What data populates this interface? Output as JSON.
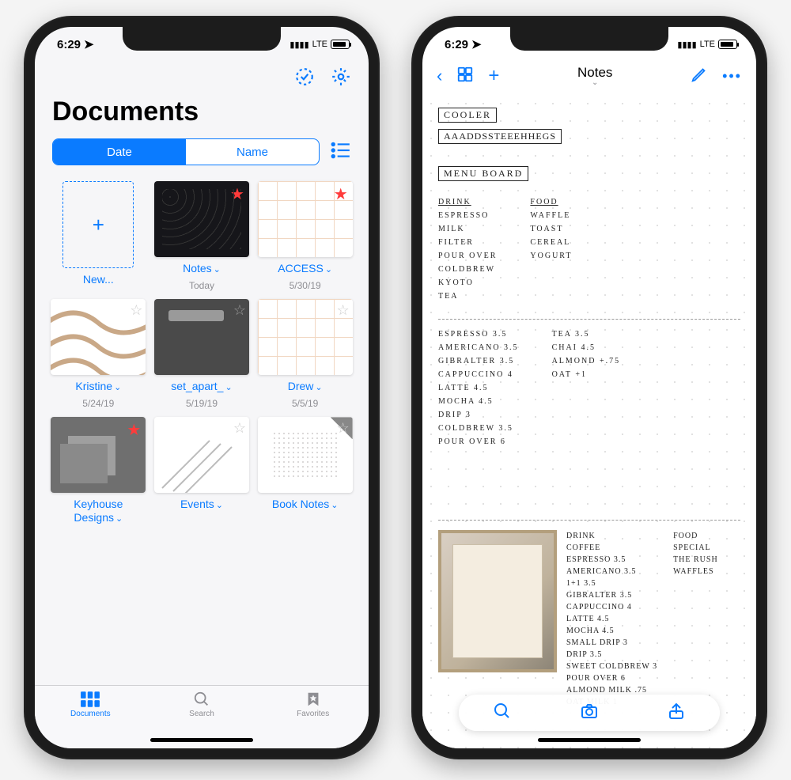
{
  "status": {
    "time": "6:29",
    "net": "LTE"
  },
  "left": {
    "title": "Documents",
    "segmented": {
      "date": "Date",
      "name": "Name"
    },
    "docs": [
      {
        "label": "New..."
      },
      {
        "label": "Notes",
        "date": "Today"
      },
      {
        "label": "ACCESS",
        "date": "5/30/19"
      },
      {
        "label": "Kristine",
        "date": "5/24/19"
      },
      {
        "label": "set_apart_",
        "date": "5/19/19"
      },
      {
        "label": "Drew",
        "date": "5/5/19"
      },
      {
        "label": "Keyhouse Designs"
      },
      {
        "label": "Events"
      },
      {
        "label": "Book Notes"
      }
    ],
    "tabs": {
      "documents": "Documents",
      "search": "Search",
      "favorites": "Favorites"
    }
  },
  "right": {
    "title": "Notes",
    "sections": {
      "cooler": "COOLER",
      "cooler_sub": "AAADDSSTEEEHHEGS",
      "menu_board": "MENU BOARD",
      "drink_h": "DRINK",
      "food_h": "FOOD",
      "drinks1": [
        "ESPRESSO",
        "MILK",
        "FILTER",
        "POUR OVER",
        "COLDBREW",
        "KYOTO",
        "TEA"
      ],
      "foods1": [
        "WAFFLE",
        "TOAST",
        "CEREAL",
        "YOGURT"
      ],
      "price_left": [
        "ESPRESSO  3.5",
        "AMERICANO 3.5",
        "GIBRALTER 3.5",
        "CAPPUCCINO 4",
        "LATTE     4.5",
        "MOCHA     4.5",
        "DRIP      3",
        "COLDBREW  3.5",
        "POUR OVER 6"
      ],
      "price_right": [
        "TEA    3.5",
        "CHAI   4.5",
        "",
        "ALMOND +.75",
        "OAT    +1"
      ],
      "photo_col1": [
        "DRINK",
        "COFFEE",
        "ESPRESSO   3.5",
        "AMERICANO  3.5",
        "1+1       3.5",
        "GIBRALTER  3.5",
        "CAPPUCCINO 4",
        "LATTE     4.5",
        "MOCHA     4.5",
        "SMALL DRIP 3",
        "DRIP      3.5",
        "SWEET COLDBREW 3",
        "POUR OVER 6",
        "",
        "ALMOND MILK .75",
        "OAT MILK   1"
      ],
      "photo_col2": [
        "FOOD",
        "SPECIAL",
        "THE RUSH",
        "",
        "WAFFLES"
      ]
    }
  }
}
